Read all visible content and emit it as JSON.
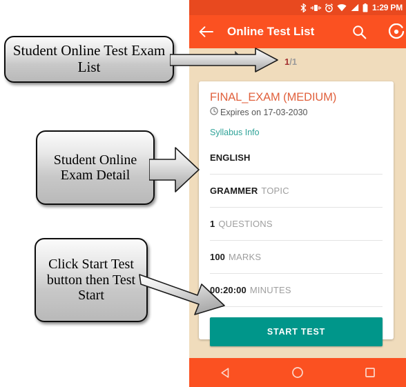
{
  "phone": {
    "status_bar": {
      "time": "1:29 PM",
      "icons": [
        "bluetooth-icon",
        "vibrate-icon",
        "alarm-icon",
        "wifi-icon",
        "signal-icon",
        "battery-icon"
      ]
    },
    "app_bar": {
      "back_icon": "back-arrow-icon",
      "title": "Online Test List",
      "search_icon": "search-icon",
      "refresh_icon": "refresh-icon"
    },
    "pager": {
      "current": "1",
      "total": "/1"
    },
    "card": {
      "title": "FINAL_EXAM (MEDIUM)",
      "expiry_icon": "clock-icon",
      "expiry": "Expires on 17-03-2030",
      "syllabus_link": "Syllabus Info",
      "rows": [
        {
          "value": "ENGLISH",
          "label": ""
        },
        {
          "value": "GRAMMER",
          "label": "TOPIC"
        },
        {
          "value": "1",
          "label": "QUESTIONS"
        },
        {
          "value": "100",
          "label": "MARKS"
        },
        {
          "value": "00:20:00",
          "label": "MINUTES"
        }
      ],
      "start_button": "START TEST"
    },
    "nav_bar": {
      "back": "back-triangle-icon",
      "home": "home-circle-icon",
      "recents": "recents-square-icon"
    }
  },
  "annotations": [
    {
      "id": "callout-1",
      "text": "Student Online Test Exam List"
    },
    {
      "id": "callout-2",
      "text": "Student Online Exam Detail"
    },
    {
      "id": "callout-3",
      "text": "Click Start Test button then Test Start"
    }
  ],
  "colors": {
    "status_bar": "#e8491f",
    "app_bar": "#fb5121",
    "screen_bg": "#f0dcbc",
    "card_bg": "#ffffff",
    "title": "#e0603c",
    "link_teal": "#2fa398",
    "button_teal": "#00968a",
    "pager_current": "#a33030"
  }
}
